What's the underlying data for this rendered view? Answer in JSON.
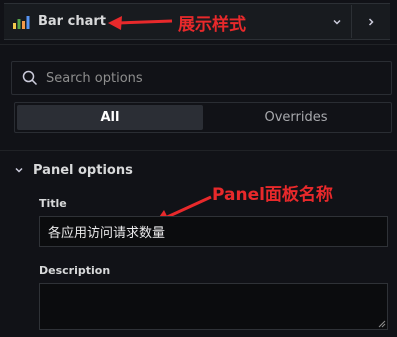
{
  "visualization": {
    "name": "Bar chart",
    "icon": "bar-chart-icon",
    "nav_icon": "chevron-right-icon",
    "dropdown_icon": "chevron-down-icon"
  },
  "annotations": {
    "viz_type": "展示样式",
    "panel_title": "Panel面板名称"
  },
  "search": {
    "placeholder": "Search options",
    "value": ""
  },
  "tabs": [
    {
      "label": "All",
      "active": true
    },
    {
      "label": "Overrides",
      "active": false
    }
  ],
  "section": {
    "label": "Panel options",
    "icon": "chevron-down-icon"
  },
  "fields": {
    "title_label": "Title",
    "title_value": "各应用访问请求数量",
    "description_label": "Description",
    "description_value": ""
  },
  "colors": {
    "accent_red": "#e8292b",
    "background": "#111217"
  }
}
